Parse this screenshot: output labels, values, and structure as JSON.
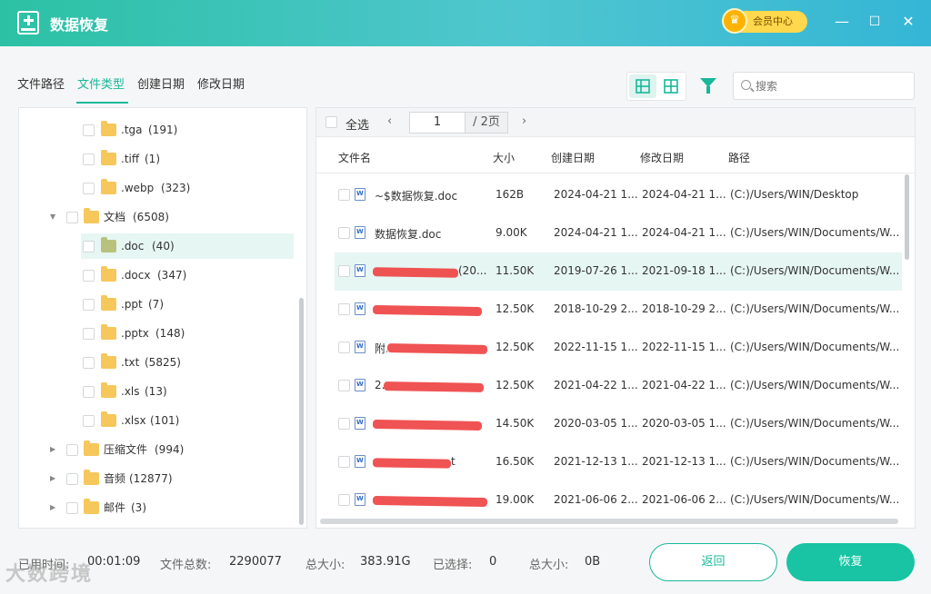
{
  "app": {
    "title": "数据恢复",
    "vip_label": "会员中心",
    "vip_icon": "crown-icon"
  },
  "tabs": [
    {
      "label": "文件路径",
      "active": false
    },
    {
      "label": "文件类型",
      "active": true
    },
    {
      "label": "创建日期",
      "active": false
    },
    {
      "label": "修改日期",
      "active": false
    }
  ],
  "search": {
    "placeholder": "搜索"
  },
  "tree": [
    {
      "label": ".tga",
      "count": "(191)",
      "level": 2
    },
    {
      "label": ".tiff",
      "count": "(1)",
      "level": 2
    },
    {
      "label": ".webp",
      "count": "(323)",
      "level": 2
    },
    {
      "label": "文档",
      "count": "(6508)",
      "level": 1,
      "expanded": true
    },
    {
      "label": ".doc",
      "count": "(40)",
      "level": 2,
      "selected": true
    },
    {
      "label": ".docx",
      "count": "(347)",
      "level": 2
    },
    {
      "label": ".ppt",
      "count": "(7)",
      "level": 2
    },
    {
      "label": ".pptx",
      "count": "(148)",
      "level": 2
    },
    {
      "label": ".txt",
      "count": "(5825)",
      "level": 2
    },
    {
      "label": ".xls",
      "count": "(13)",
      "level": 2
    },
    {
      "label": ".xlsx",
      "count": "(101)",
      "level": 2
    },
    {
      "label": "压缩文件",
      "count": "(994)",
      "level": 1,
      "expanded": false
    },
    {
      "label": "音频",
      "count": "(12877)",
      "level": 1,
      "expanded": false
    },
    {
      "label": "邮件",
      "count": "(3)",
      "level": 1,
      "expanded": false
    }
  ],
  "pager": {
    "select_all": "全选",
    "current_page": "1",
    "total_pages": "/ 2页",
    "prev": "‹",
    "next": "›"
  },
  "columns": [
    "文件名",
    "大小",
    "创建日期",
    "修改日期",
    "路径"
  ],
  "files": [
    {
      "name": "~$数据恢复.doc",
      "size": "162B",
      "created": "2024-04-21 1...",
      "modified": "2024-04-21 1...",
      "path": "(C:)/Users/WIN/Desktop",
      "redacted": false
    },
    {
      "name": "数据恢复.doc",
      "size": "9.00K",
      "created": "2024-04-21 1...",
      "modified": "2024-04-21 1...",
      "path": "(C:)/Users/WIN/Documents/W...",
      "redacted": false
    },
    {
      "name": "(20...",
      "size": "11.50K",
      "created": "2019-07-26 1...",
      "modified": "2021-09-18 1...",
      "path": "(C:)/Users/WIN/Documents/W...",
      "redacted": true,
      "selected": true
    },
    {
      "name": "",
      "size": "12.50K",
      "created": "2018-10-29 2...",
      "modified": "2018-10-29 2...",
      "path": "(C:)/Users/WIN/Documents/W...",
      "redacted": true
    },
    {
      "name": "附...",
      "size": "12.50K",
      "created": "2022-11-15 1...",
      "modified": "2022-11-15 1...",
      "path": "(C:)/Users/WIN/Documents/W...",
      "redacted": true
    },
    {
      "name": "2...",
      "size": "12.50K",
      "created": "2021-04-22 1...",
      "modified": "2021-04-22 1...",
      "path": "(C:)/Users/WIN/Documents/W...",
      "redacted": true
    },
    {
      "name": "",
      "size": "14.50K",
      "created": "2020-03-05 1...",
      "modified": "2020-03-05 1...",
      "path": "(C:)/Users/WIN/Documents/W...",
      "redacted": true
    },
    {
      "name": "t",
      "size": "16.50K",
      "created": "2021-12-13 1...",
      "modified": "2021-12-13 1...",
      "path": "(C:)/Users/WIN/Documents/W...",
      "redacted": true
    },
    {
      "name": "",
      "size": "19.00K",
      "created": "2021-06-06 2...",
      "modified": "2021-06-06 2...",
      "path": "(C:)/Users/WIN/Documents/W...",
      "redacted": true
    }
  ],
  "footer": {
    "elapsed_label": "已用时间:",
    "elapsed_value": "00:01:09",
    "total_files_label": "文件总数:",
    "total_files_value": "2290077",
    "total_size_label": "总大小:",
    "total_size_value": "383.91G",
    "selected_label": "已选择:",
    "selected_value": "0",
    "selected_size_label": "总大小:",
    "selected_size_value": "0B",
    "back_label": "返回",
    "restore_label": "恢复"
  },
  "watermark": "大数跨境",
  "colors": {
    "accent": "#18b89a",
    "selected_row": "#e6f6f3",
    "vip": "#ffd84d"
  }
}
